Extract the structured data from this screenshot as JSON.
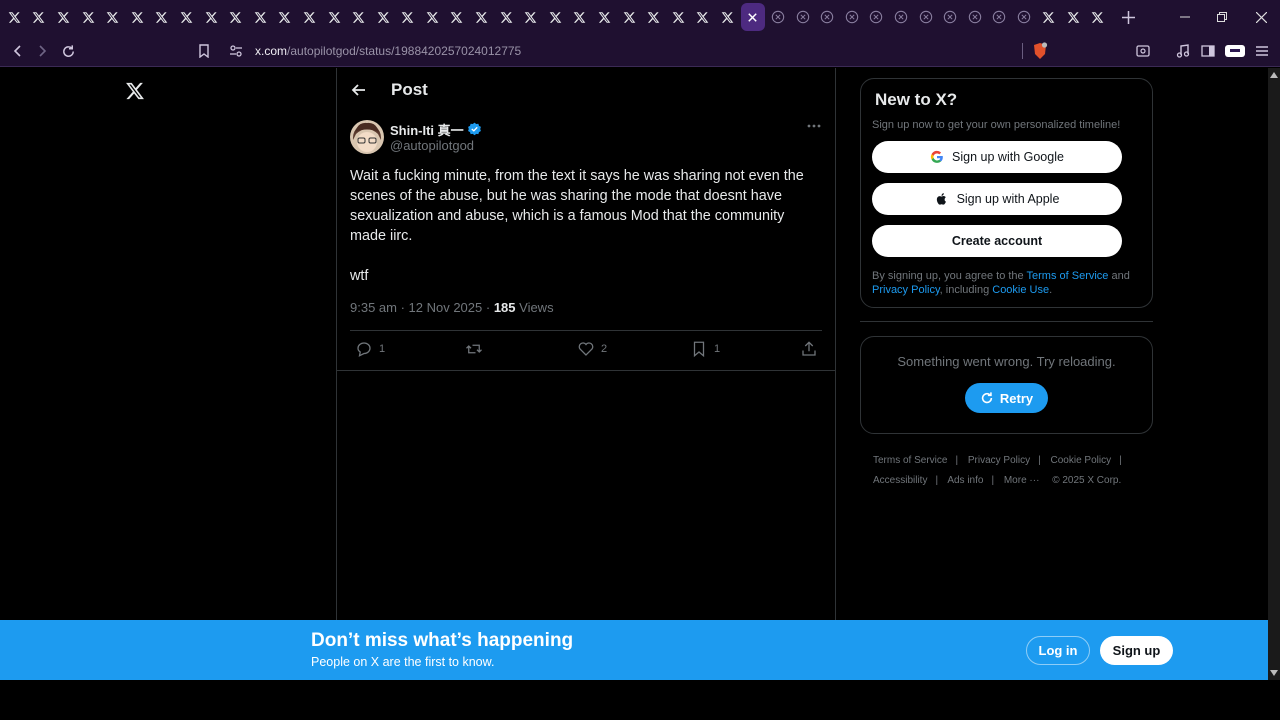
{
  "browser": {
    "tabs_x_count": 33,
    "tabs_crashed_count": 11,
    "tabs_x_after_crashed": 3,
    "url_host": "x.com",
    "url_path": "/autopilotgod/status/1988420257024012775",
    "accent": "#1f1030"
  },
  "post_header": {
    "title": "Post"
  },
  "tweet": {
    "display_name": "Shin-Iti 真一",
    "handle": "@autopilotgod",
    "paragraphs": [
      "Wait a fucking minute, from the text it says he was sharing not even the scenes of the abuse, but he was sharing the mode that doesnt have sexualization and abuse, which is a famous Mod that the community made iirc.",
      "wtf"
    ],
    "time": "9:35 am · 12 Nov 2025 · ",
    "views_count": "185",
    "views_label": " Views",
    "replies": "1",
    "likes": "2",
    "bookmarks": "1"
  },
  "signup_card": {
    "title": "New to X?",
    "subtitle": "Sign up now to get your own personalized timeline!",
    "google": "Sign up with Google",
    "apple": "Sign up with Apple",
    "create": "Create account",
    "legal_prefix": "By signing up, you agree to the ",
    "tos": "Terms of Service",
    "and": " and ",
    "privacy": "Privacy Policy",
    "including": ", including ",
    "cookie": "Cookie Use",
    "period": "."
  },
  "error_card": {
    "message": "Something went wrong. Try reloading.",
    "retry": "Retry"
  },
  "footer": {
    "tos": "Terms of Service",
    "privacy": "Privacy Policy",
    "cookie": "Cookie Policy",
    "accessibility": "Accessibility",
    "ads": "Ads info",
    "more": "More ···",
    "copyright": "© 2025 X Corp."
  },
  "banner": {
    "headline": "Don’t miss what’s happening",
    "sub": "People on X are the first to know.",
    "login": "Log in",
    "signup": "Sign up",
    "color": "#1d9bf0"
  }
}
